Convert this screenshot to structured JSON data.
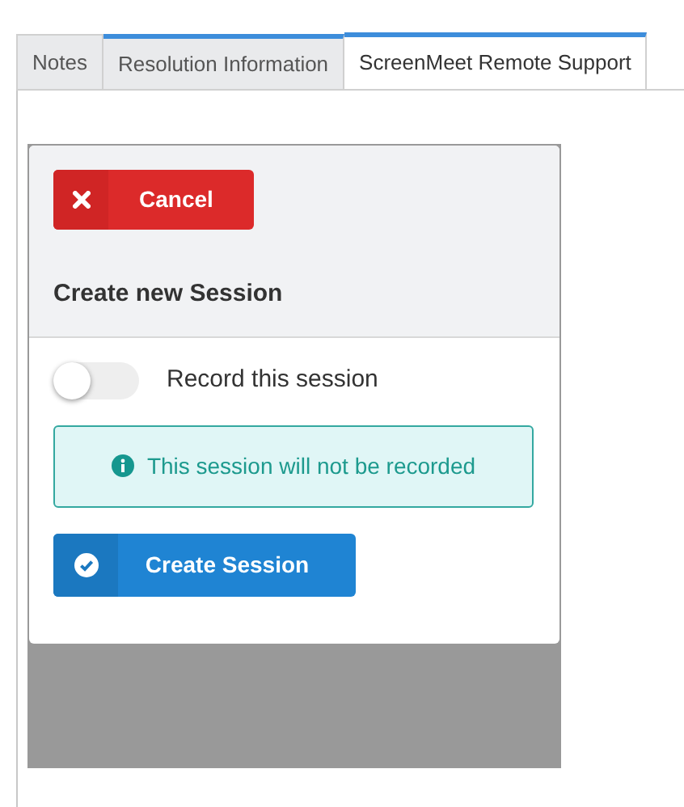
{
  "tabs": [
    {
      "label": "Notes",
      "selected": false
    },
    {
      "label": "Resolution Information",
      "selected": false
    },
    {
      "label": "ScreenMeet Remote Support",
      "selected": true
    }
  ],
  "dialog": {
    "cancel_button": "Cancel",
    "title": "Create new Session",
    "record_toggle": {
      "label": "Record this session",
      "on": false
    },
    "info": "This session will not be recorded",
    "create_button": "Create Session"
  }
}
